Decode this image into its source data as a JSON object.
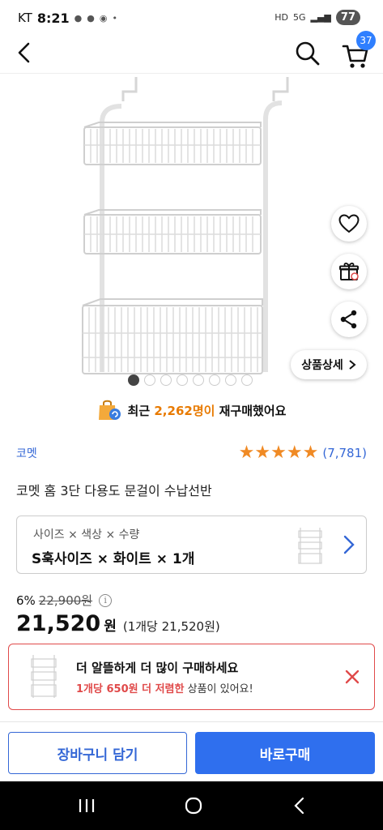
{
  "status_bar": {
    "carrier": "KT",
    "time": "8:21",
    "network": "5G",
    "battery": "77"
  },
  "nav": {
    "cart_count": "37"
  },
  "image": {
    "slide_count": 8,
    "active_slide": 1,
    "detail_label": "상품상세"
  },
  "repurchase": {
    "prefix": "최근",
    "count": "2,262명이",
    "suffix": "재구매했어요"
  },
  "product": {
    "brand": "코멧",
    "rating_stars": 5,
    "review_count": "(7,781)",
    "title": "코멧 홈 3단 다용도 문걸이 수납선반"
  },
  "option": {
    "label": "사이즈 × 색상 × 수량",
    "value": "S훅사이즈 × 화이트 × 1개"
  },
  "price": {
    "discount": "6%",
    "original": "22,900원",
    "current": "21,520",
    "won": "원",
    "unit": "(1개당 21,520원)"
  },
  "promo": {
    "line1": "더 알뜰하게 더 많이 구매하세요",
    "line2_highlight": "1개당 650원 더 저렴한",
    "line2_rest": " 상품이 있어요!",
    "accent_color": "#e04a4a"
  },
  "buttons": {
    "add_to_cart": "장바구니 담기",
    "buy_now": "바로구매"
  },
  "colors": {
    "brand_blue": "#3467d6",
    "buy_button": "#2f6fee",
    "star": "#f08a24",
    "highlight_orange": "#e87a00"
  }
}
